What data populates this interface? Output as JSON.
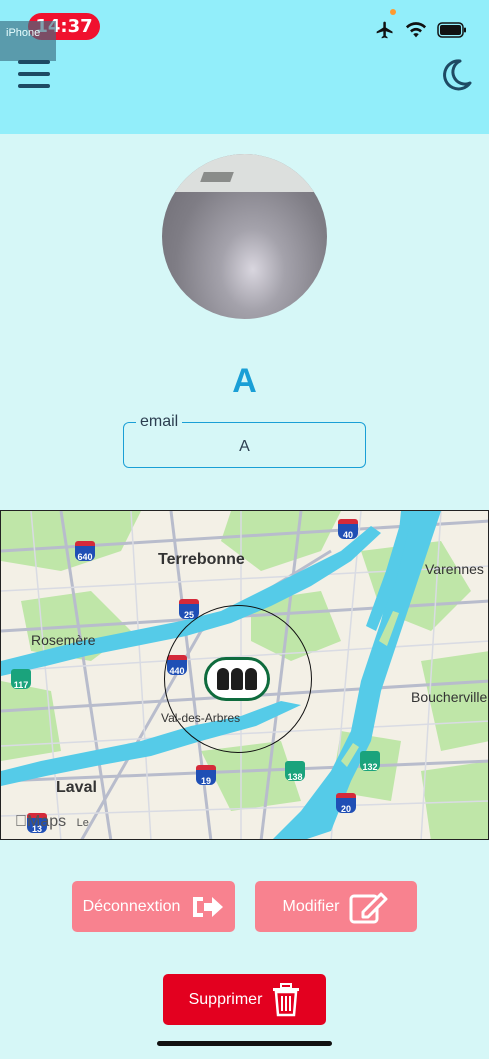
{
  "status_bar": {
    "time": "14:37",
    "device_label": "iPhone",
    "icons": [
      "airplane-icon",
      "wifi-icon",
      "battery-icon"
    ],
    "time_pill_color": "#f0112e"
  },
  "header": {
    "menu_icon": "hamburger-menu-icon",
    "theme_icon": "moon-icon",
    "background": "#92eefa"
  },
  "profile": {
    "name": "A",
    "email_label": "email",
    "email_value": "A",
    "accent_color": "#1a9fd6"
  },
  "map": {
    "labels": {
      "terrebonne": "Terrebonne",
      "rosemere": "Rosemère",
      "val_des_arbres": "Val-des-Arbres",
      "laval": "Laval",
      "varennes": "Varennes",
      "boucherville": "Boucherville",
      "brand": "Maps",
      "legal": "Le"
    },
    "highway_shields": [
      {
        "number": "640",
        "kind": "autoroute"
      },
      {
        "number": "25",
        "kind": "autoroute"
      },
      {
        "number": "40",
        "kind": "autoroute"
      },
      {
        "number": "440",
        "kind": "autoroute"
      },
      {
        "number": "117",
        "kind": "route"
      },
      {
        "number": "19",
        "kind": "autoroute"
      },
      {
        "number": "138",
        "kind": "route"
      },
      {
        "number": "132",
        "kind": "route"
      },
      {
        "number": "20",
        "kind": "autoroute"
      },
      {
        "number": "13",
        "kind": "autoroute"
      }
    ]
  },
  "buttons": {
    "logout": {
      "label": "Déconnextion",
      "icon": "sign-out-icon",
      "color": "#f8828f"
    },
    "edit": {
      "label": "Modifier",
      "icon": "edit-icon",
      "color": "#f8828f"
    },
    "delete": {
      "label": "Supprimer",
      "icon": "trash-icon",
      "color": "#e3001f"
    }
  }
}
